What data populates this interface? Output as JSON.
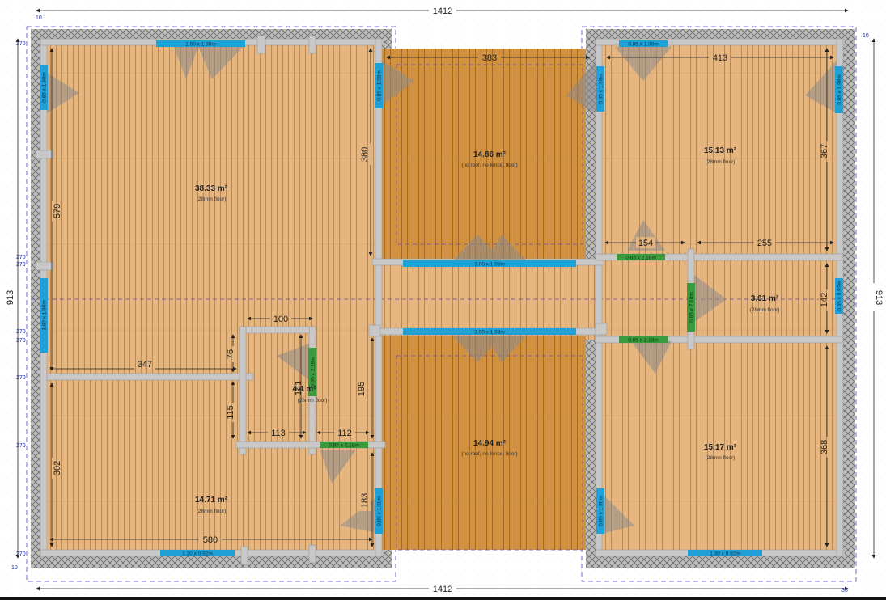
{
  "overall": {
    "width_top": "1412",
    "width_bottom": "1412",
    "height_left": "913",
    "height_right": "913",
    "corner_tl": "10",
    "corner_tr": "10",
    "corner_bl": "10",
    "corner_br": "35"
  },
  "side_marks": [
    "270",
    "270",
    "270",
    "270",
    "270",
    "270",
    "270",
    "270"
  ],
  "rooms": {
    "big_left": {
      "area": "38.33 m²",
      "note": "(28mm floor)"
    },
    "small_center": {
      "area": "4.4 m²",
      "note": "(28mm floor)"
    },
    "bottom_left": {
      "area": "14.71 m²",
      "note": "(28mm floor)"
    },
    "terrace_top": {
      "area": "14.86 m²",
      "note": "(no roof, no fence, floor)"
    },
    "terrace_bottom": {
      "area": "14.94 m²",
      "note": "(no roof, no fence, floor)"
    },
    "top_right": {
      "area": "15.13 m²",
      "note": "(28mm floor)"
    },
    "mid_right": {
      "area": "3.61 m²",
      "note": "(28mm floor)"
    },
    "bottom_right": {
      "area": "15.17 m²",
      "note": "(28mm floor)"
    }
  },
  "dims": {
    "d383": "383",
    "d413": "413",
    "d380": "380",
    "d367": "367",
    "d579": "579",
    "d154": "154",
    "d255": "255",
    "d142": "142",
    "d100": "100",
    "d347": "347",
    "d76": "76",
    "d195": "195",
    "d115": "115",
    "d113": "113",
    "d112": "112",
    "d141": "141",
    "d302": "302",
    "d183": "183",
    "d580": "580",
    "d368": "368"
  },
  "windows": {
    "w_top_left": "1.60 x 1.98m",
    "w_left_upper": "0.85 x 1.98m",
    "w_left_lower": "1.80 x 1.98m",
    "w_col_upper": "0.85 x 1.98m",
    "w_col_lower": "0.85 x 1.98m",
    "w_center_top": "3.00 x 1.98m",
    "w_center_bottom": "3.00 x 1.98m",
    "w_right_col_upper": "0.85 x 1.98m",
    "w_right_col_lower": "0.85 x 1.98m",
    "w_top_right": "0.85 x 1.98m",
    "w_right_upper": "0.85 x 1.98m",
    "w_right_mid": "0.85 x 0.92m",
    "w_bottom_left": "1.30 x 0.92m",
    "w_bottom_right": "1.30 x 0.92m"
  },
  "doors": {
    "d_right_upper": "0.85 x 2.18m",
    "d_right_vertical": "0.85 x 2.18m",
    "d_right_lower": "0.85 x 2.18m",
    "d_small_vertical": "0.85 x 2.18m",
    "d_small_bottom": "0.85 x 2.18m"
  },
  "colors": {
    "floor": "#e6b681",
    "terrace": "#d2913f",
    "wall": "#c8c8c8",
    "window": "#1fa0d6",
    "door": "#3a9a3e",
    "dim_line": "#222222",
    "outline": "#4a4ad0"
  }
}
